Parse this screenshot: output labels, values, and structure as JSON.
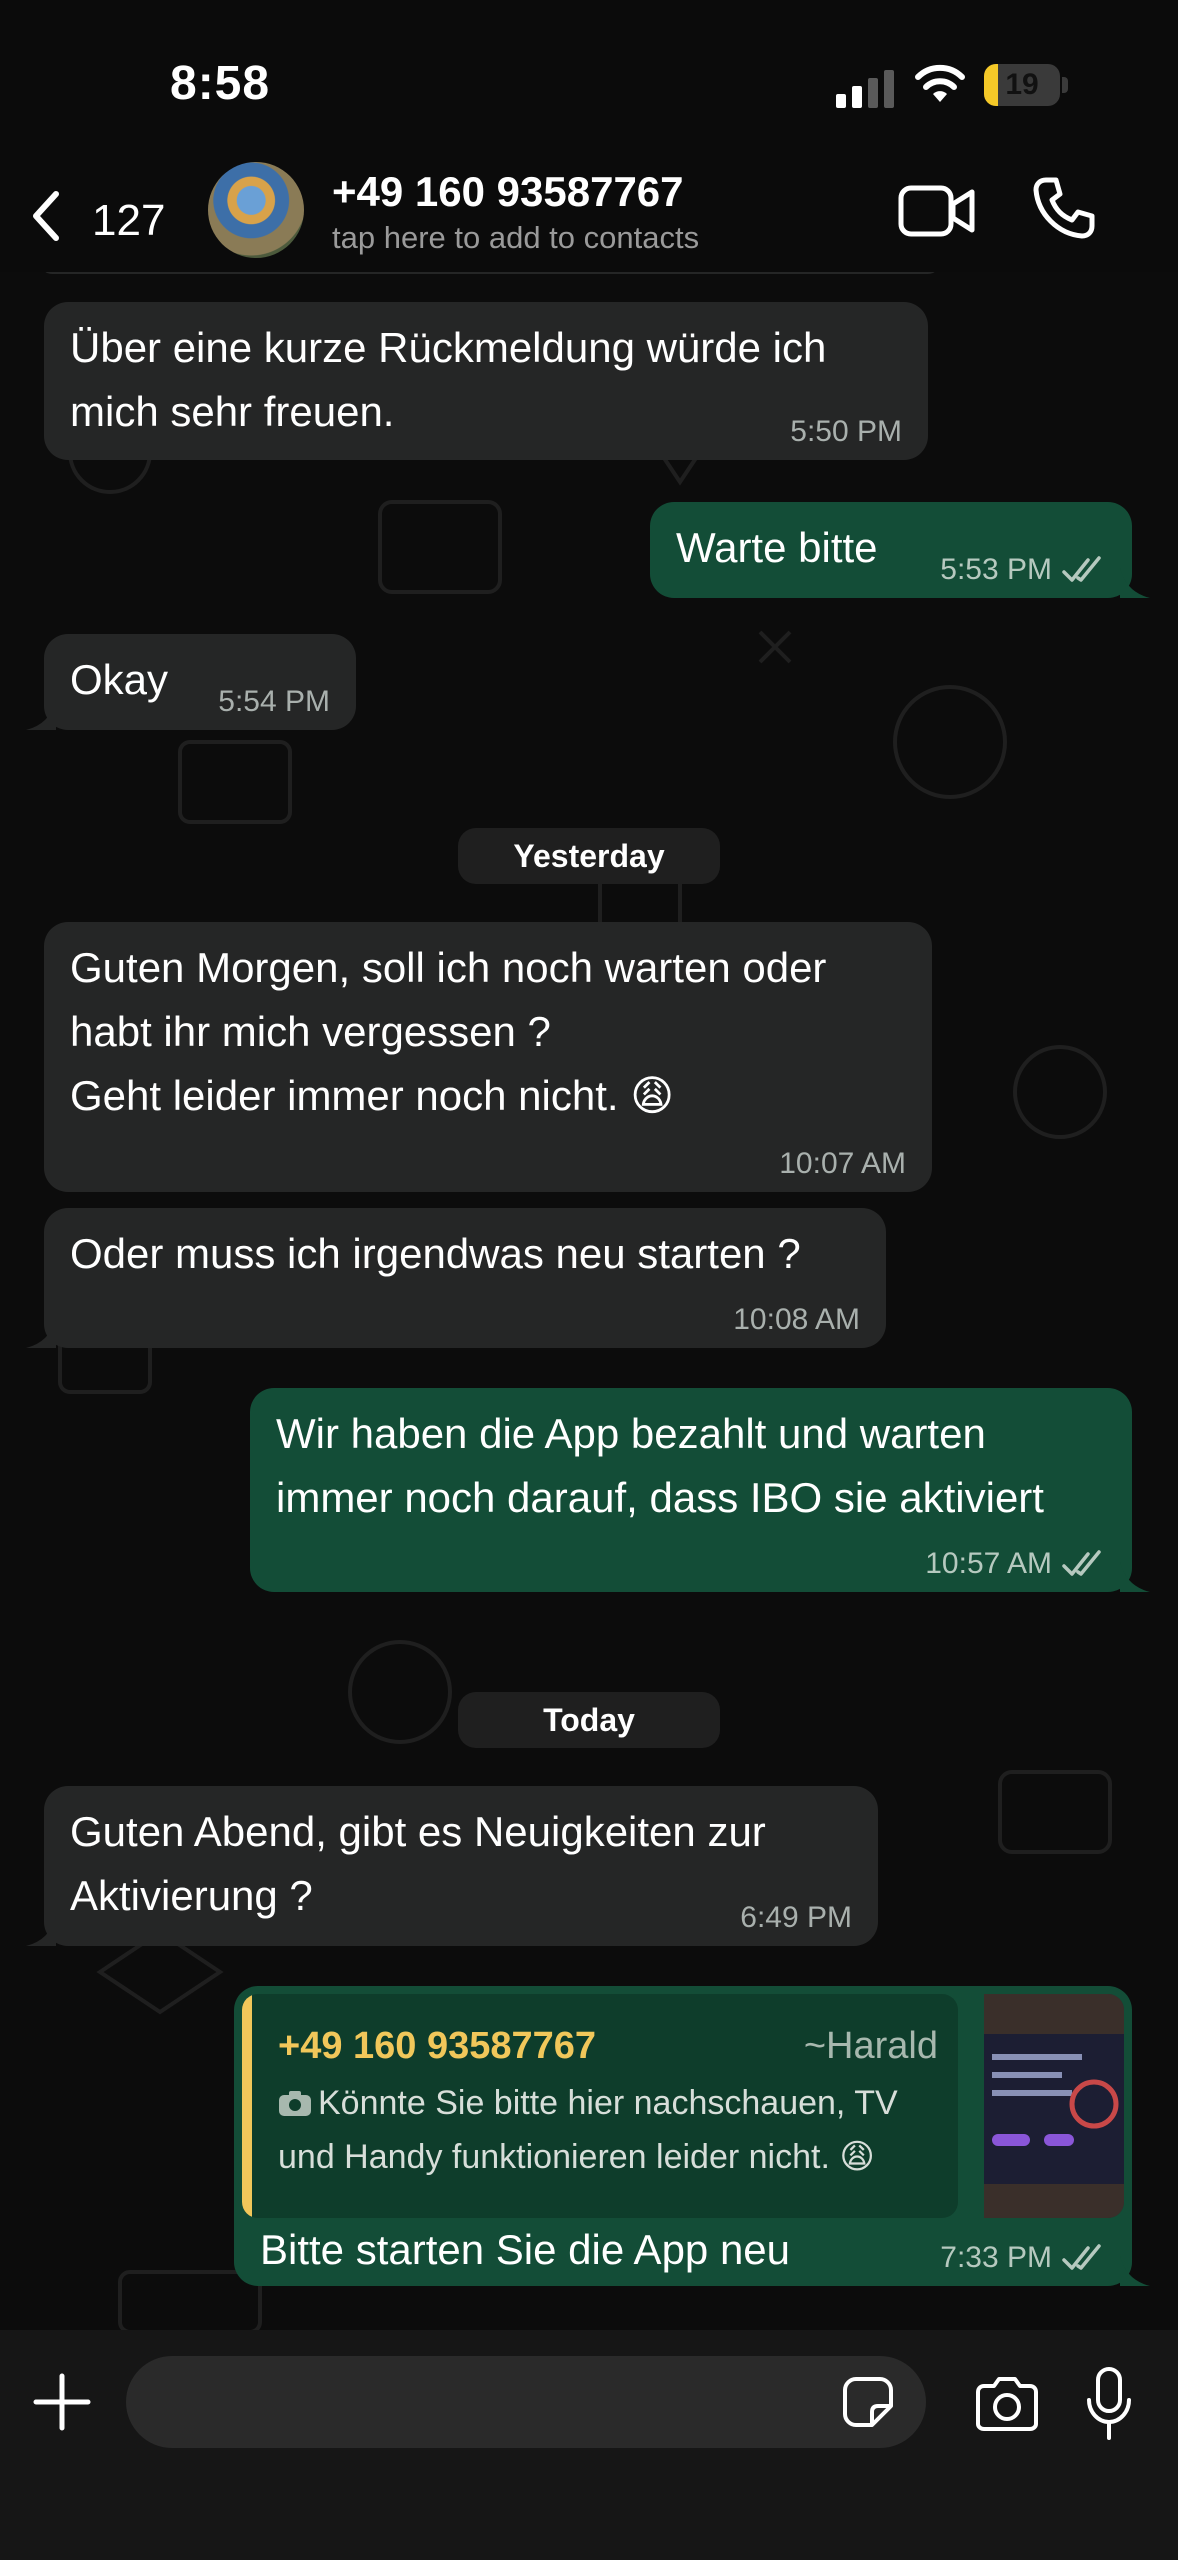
{
  "status_bar": {
    "time": "8:58",
    "battery": "19",
    "battery_level_percent": 19,
    "battery_color": "#f5c928"
  },
  "header": {
    "back_icon": "chevron-left-icon",
    "back_count": "127",
    "contact_name": "+49 160 93587767",
    "contact_subtitle": "tap here to add to contacts",
    "video_icon": "video-camera-icon",
    "call_icon": "phone-icon"
  },
  "messages": [
    {
      "direction": "in",
      "text": "Über eine kurze Rückmeldung würde ich\nmich sehr freuen.",
      "time": "5:50 PM"
    },
    {
      "direction": "out",
      "text": "Warte bitte",
      "time": "5:53 PM",
      "status": "read"
    },
    {
      "direction": "in",
      "text": "Okay",
      "time": "5:54 PM"
    },
    {
      "direction": "in",
      "text": "Guten Morgen, soll ich noch warten oder\nhabt ihr mich vergessen ?\nGeht leider immer noch nicht. 😩",
      "time": "10:07 AM"
    },
    {
      "direction": "in",
      "text": "Oder muss ich irgendwas neu starten ?",
      "time": "10:08 AM"
    },
    {
      "direction": "out",
      "text": "Wir haben die App bezahlt und warten\nimmer noch darauf, dass IBO sie aktiviert",
      "time": "10:57 AM",
      "status": "read"
    },
    {
      "direction": "in",
      "text": "Guten Abend, gibt es Neuigkeiten zur\nAktivierung ?",
      "time": "6:49 PM"
    },
    {
      "direction": "out",
      "text": "Bitte starten Sie die App neu",
      "time": "7:33 PM",
      "status": "read"
    }
  ],
  "date_separators": [
    "Yesterday",
    "Today"
  ],
  "reply_quote": {
    "name": "+49 160 93587767",
    "alias": "~Harald",
    "icon": "camera-icon",
    "text": "Könnte Sie bitte hier nachschauen, TV\nund Handy funktionieren leider nicht. 😩"
  },
  "input_bar": {
    "plus_icon": "plus-icon",
    "sticker_icon": "sticker-icon",
    "camera_icon": "camera-icon",
    "mic_icon": "microphone-icon"
  },
  "colors": {
    "incoming_bubble": "#252626",
    "outgoing_bubble": "#134d37",
    "quote_accent": "#f1c75a",
    "read_ticks": "#b6c9bf"
  }
}
